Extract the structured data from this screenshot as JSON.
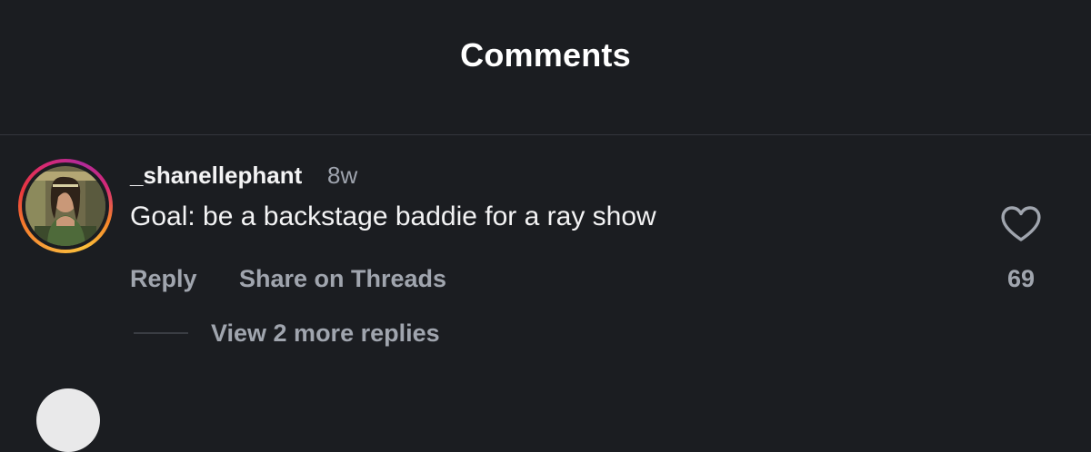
{
  "header": {
    "title": "Comments"
  },
  "comment": {
    "username": "_shanellephant",
    "timestamp": "8w",
    "text": "Goal: be a backstage baddie for a ray show",
    "reply_label": "Reply",
    "share_label": "Share on Threads",
    "like_count": "69",
    "view_replies_label": "View 2 more replies",
    "avatar_has_story_ring": true
  },
  "icons": {
    "like": "heart-outline-icon"
  },
  "colors": {
    "background": "#1b1d21",
    "primary_text": "#f3f3f4",
    "secondary_text": "#a0a5ae",
    "divider": "#33363c",
    "story_ring": [
      "#f9a63a",
      "#e8373e",
      "#d62976",
      "#b12a9a"
    ]
  }
}
